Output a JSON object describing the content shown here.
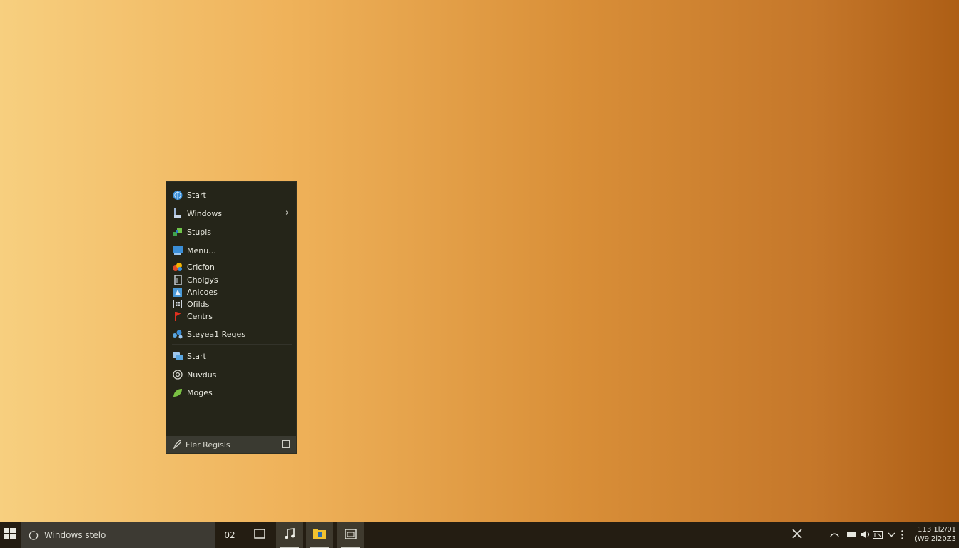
{
  "start_menu": {
    "items": [
      {
        "label": "Start",
        "icon": "globe-icon"
      },
      {
        "label": "Windows",
        "icon": "window-icon",
        "has_submenu": true
      },
      {
        "label": "Stupls",
        "icon": "network-icon"
      },
      {
        "label": "Menu...",
        "icon": "monitor-icon"
      },
      {
        "label": "Cricfon",
        "icon": "colorful-app-icon"
      },
      {
        "label": "Cholgys",
        "icon": "document-icon"
      },
      {
        "label": "Anlcoes",
        "icon": "image-icon"
      },
      {
        "label": "Ofilds",
        "icon": "grid-icon"
      },
      {
        "label": "Centrs",
        "icon": "flag-icon"
      },
      {
        "label": "Steyea1 Reges",
        "icon": "share-icon"
      },
      {
        "label": "Start",
        "icon": "chat-icon"
      },
      {
        "label": "Nuvdus",
        "icon": "settings-icon"
      },
      {
        "label": "Moges",
        "icon": "leaf-icon"
      }
    ],
    "footer": {
      "label": "Fler Regisls",
      "icon": "pen-icon",
      "button_icon": "grid-view-icon"
    }
  },
  "taskbar": {
    "search_label": "Windows stelo",
    "task_view_label": "02",
    "clock": {
      "time": "113   1l2/01",
      "date": "(W9l2l20Z3"
    }
  },
  "colors": {
    "menu_bg": "#252519",
    "taskbar_bg": "#241d12",
    "wallpaper_left": "#f7cf7f",
    "wallpaper_right": "#ad5e15"
  }
}
